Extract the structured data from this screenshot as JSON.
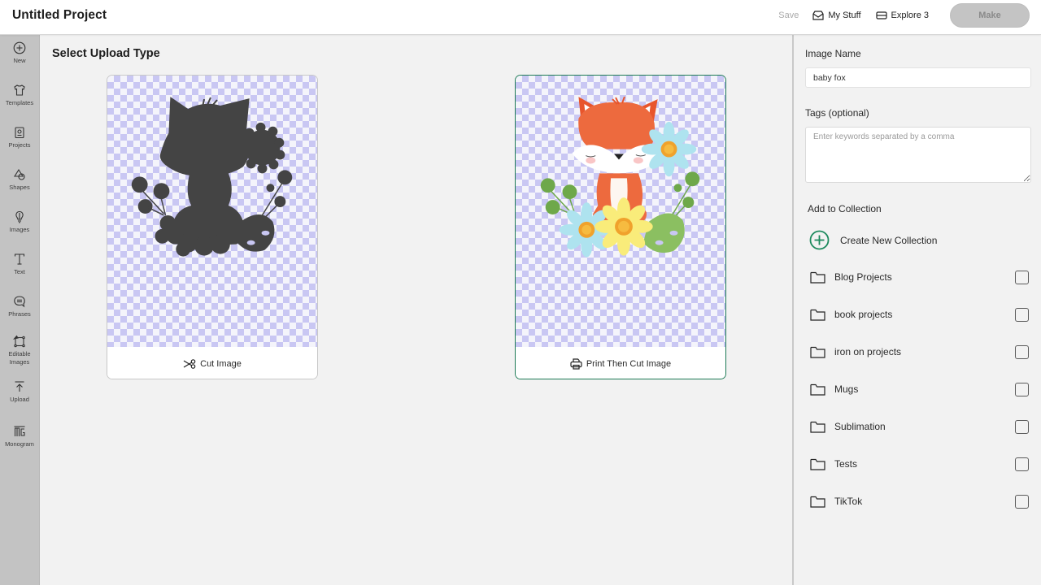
{
  "header": {
    "project_title": "Untitled Project",
    "save_label": "Save",
    "my_stuff_label": "My Stuff",
    "machine_label": "Explore 3",
    "make_label": "Make"
  },
  "sidebar": {
    "items": [
      {
        "label": "New",
        "icon": "plus-circle-icon"
      },
      {
        "label": "Templates",
        "icon": "tshirt-icon"
      },
      {
        "label": "Projects",
        "icon": "projects-icon"
      },
      {
        "label": "Shapes",
        "icon": "shapes-icon"
      },
      {
        "label": "Images",
        "icon": "lightbulb-icon"
      },
      {
        "label": "Text",
        "icon": "text-icon"
      },
      {
        "label": "Phrases",
        "icon": "speech-bubble-icon"
      },
      {
        "label": "Editable Images",
        "icon": "editable-images-icon"
      },
      {
        "label": "Upload",
        "icon": "upload-icon"
      },
      {
        "label": "Monogram",
        "icon": "monogram-icon"
      }
    ]
  },
  "main": {
    "title": "Select Upload Type",
    "options": [
      {
        "label": "Cut Image",
        "icon": "scissors-icon",
        "selected": false
      },
      {
        "label": "Print Then Cut Image",
        "icon": "printer-icon",
        "selected": true
      }
    ]
  },
  "panel": {
    "image_name_label": "Image Name",
    "image_name_value": "baby fox",
    "tags_label": "Tags (optional)",
    "tags_placeholder": "Enter keywords separated by a comma",
    "tags_value": "",
    "collection_title": "Add to Collection",
    "create_collection_label": "Create New Collection",
    "collections": [
      {
        "name": "Blog Projects",
        "checked": false
      },
      {
        "name": "book projects",
        "checked": false
      },
      {
        "name": "iron on projects",
        "checked": false
      },
      {
        "name": "Mugs",
        "checked": false
      },
      {
        "name": "Sublimation",
        "checked": false
      },
      {
        "name": "Tests",
        "checked": false
      },
      {
        "name": "TikTok",
        "checked": false
      }
    ]
  },
  "colors": {
    "accent_green": "#1d7a55",
    "make_disabled": "#c4c4c4",
    "checker_purple": "#c9c7f3"
  }
}
